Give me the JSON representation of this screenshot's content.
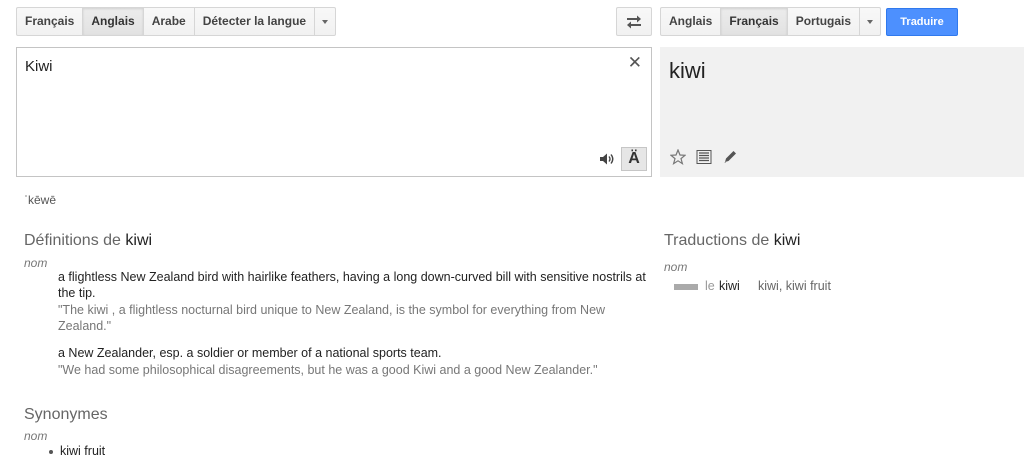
{
  "source_langs": [
    "Français",
    "Anglais",
    "Arabe",
    "Détecter la langue"
  ],
  "source_selected_index": 1,
  "target_langs": [
    "Anglais",
    "Français",
    "Portugais"
  ],
  "target_selected_index": 1,
  "translate_label": "Traduire",
  "input_text": "Kiwi",
  "clear_glyph": "✕",
  "keyboard_glyph": "Ä",
  "result_text": "kiwi",
  "transliteration": "ˈkēwē",
  "definitions": {
    "heading_prefix": "Définitions de",
    "word": "kiwi",
    "pos": "nom",
    "items": [
      {
        "text": "a flightless New Zealand bird with hairlike feathers, having a long down-curved bill with sensitive nostrils at the tip.",
        "example": "\"The kiwi , a flightless nocturnal bird unique to New Zealand, is the symbol for everything from New Zealand.\""
      },
      {
        "text": "a New Zealander, esp. a soldier or member of a national sports team.",
        "example": "\"We had some philosophical disagreements, but he was a good Kiwi and a good New Zealander.\""
      }
    ]
  },
  "translations": {
    "heading_prefix": "Traductions de",
    "word": "kiwi",
    "pos": "nom",
    "article": "le",
    "term": "kiwi",
    "synonyms": "kiwi, kiwi fruit",
    "frequency": 0.3
  },
  "synonyms": {
    "heading": "Synonymes",
    "pos": "nom",
    "items": [
      "kiwi fruit"
    ]
  },
  "icons": {
    "swap": "swap-arrows-icon",
    "speaker": "speaker-icon",
    "star": "star-icon",
    "list": "list-icon",
    "pencil": "pencil-icon"
  },
  "colors": {
    "accent": "#4d90fe",
    "result_bg": "#f1f1f1"
  }
}
